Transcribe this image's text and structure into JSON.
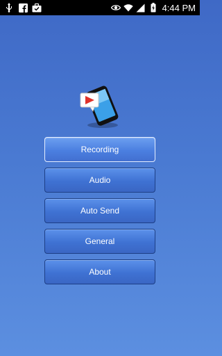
{
  "status_bar": {
    "time": "4:44 PM",
    "left_icons": [
      "usb-icon",
      "facebook-icon",
      "briefcase-icon"
    ],
    "right_icons": [
      "eye-icon",
      "wifi-icon",
      "signal-icon",
      "battery-icon"
    ]
  },
  "logo": {
    "icon": "phone-record-icon"
  },
  "menu": {
    "items": [
      {
        "label": "Recording",
        "selected": true
      },
      {
        "label": "Audio"
      },
      {
        "label": "Auto Send"
      },
      {
        "label": "General"
      },
      {
        "label": "About"
      }
    ]
  },
  "colors": {
    "bg_top": "#3f69c6",
    "bg_bottom": "#5c8fe0",
    "button": "#4a7ad8",
    "button_border": "#1d3f86",
    "selected_border": "#e6efff"
  }
}
